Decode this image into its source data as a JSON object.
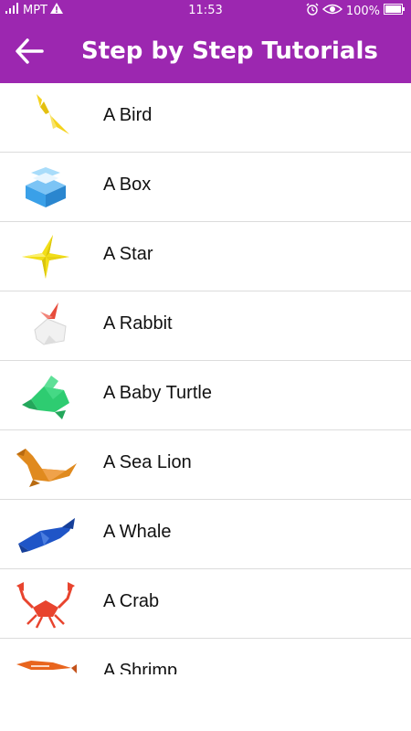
{
  "status_bar": {
    "carrier": "MPT",
    "time": "11:53",
    "battery": "100%",
    "icons": [
      "signal-icon",
      "warning-icon",
      "alarm-icon",
      "eye-icon",
      "battery-icon"
    ]
  },
  "app_bar": {
    "title": "Step by Step Tutorials",
    "back_icon": "arrow-left-icon",
    "color": "#9c27b0"
  },
  "tutorials": [
    {
      "label": "A Bird",
      "icon": "origami-bird-icon",
      "color": "#f5d31c"
    },
    {
      "label": "A Box",
      "icon": "origami-box-icon",
      "color": "#3aa0e8"
    },
    {
      "label": "A Star",
      "icon": "origami-star-icon",
      "color": "#f2de18"
    },
    {
      "label": "A Rabbit",
      "icon": "origami-rabbit-icon",
      "color": "#e74c3c"
    },
    {
      "label": "A Baby Turtle",
      "icon": "origami-turtle-icon",
      "color": "#2ecc71"
    },
    {
      "label": "A Sea Lion",
      "icon": "origami-sea-lion-icon",
      "color": "#e08a1e"
    },
    {
      "label": "A Whale",
      "icon": "origami-whale-icon",
      "color": "#1f55c7"
    },
    {
      "label": "A Crab",
      "icon": "origami-crab-icon",
      "color": "#e8442e"
    },
    {
      "label": "A Shrimp",
      "icon": "origami-shrimp-icon",
      "color": "#e8651e"
    }
  ]
}
